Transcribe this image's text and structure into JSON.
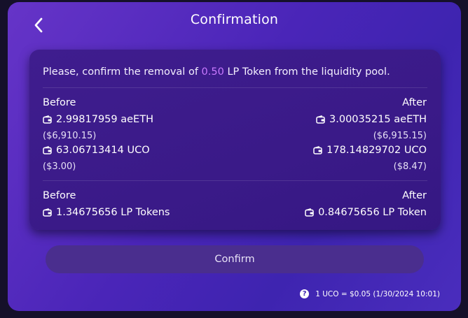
{
  "header": {
    "title": "Confirmation",
    "back_icon": "chevron-left-icon"
  },
  "card": {
    "intro_prefix": "Please, confirm the removal of ",
    "intro_amount": "0.50",
    "intro_suffix": " LP Token from the liquidity pool.",
    "amount_color": "#c879ff",
    "tokens": {
      "before_label": "Before",
      "after_label": "After",
      "before": [
        {
          "amount": "2.99817959 aeETH",
          "fiat": "($6,910.15)"
        },
        {
          "amount": "63.06713414 UCO",
          "fiat": "($3.00)"
        }
      ],
      "after": [
        {
          "amount": "3.00035215 aeETH",
          "fiat": "($6,915.15)"
        },
        {
          "amount": "178.14829702 UCO",
          "fiat": "($8.47)"
        }
      ]
    },
    "lp": {
      "before_label": "Before",
      "after_label": "After",
      "before_amount": "1.34675656 LP Tokens",
      "after_amount": "0.84675656 LP Token"
    },
    "wallet_icon": "wallet-icon"
  },
  "actions": {
    "confirm_label": "Confirm"
  },
  "footer": {
    "help_icon": "help-circle-icon",
    "help_glyph": "?",
    "rate_text": "1 UCO = $0.05 (1/30/2024 10:01)"
  },
  "colors": {
    "panel_start": "#6634c8",
    "panel_end": "#3e24b0",
    "card": "#3f1d8e",
    "button": "#4a2e8e",
    "accent": "#c879ff"
  }
}
